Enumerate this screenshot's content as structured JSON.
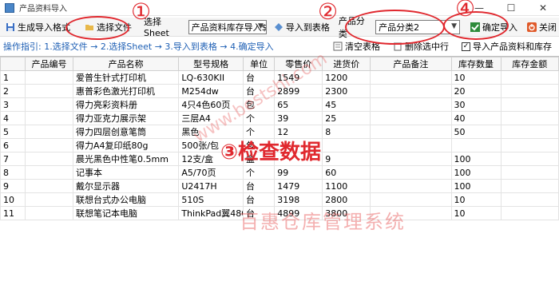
{
  "window": {
    "title": "产品资料导入",
    "minimize": "—",
    "maximize": "☐",
    "close": "✕"
  },
  "toolbar": {
    "gen_format": "生成导入格式",
    "select_file": "选择文件",
    "select_sheet_label": "选择Sheet",
    "sheet_value": "产品资料库存导入$",
    "import_table": "导入到表格",
    "category_label": "产品分类",
    "category_value": "产品分类2",
    "confirm_import": "确定导入",
    "close": "关闭"
  },
  "guide": {
    "text": "操作指引: 1.选择文件 → 2.选择Sheet → 3.导入到表格 → 4.确定导入",
    "clear_table": "清空表格",
    "delete_row": "删除选中行",
    "import_checkbox": "导入产品资料和库存",
    "import_checked": true
  },
  "table": {
    "headers": [
      "",
      "产品编号",
      "产品名称",
      "型号规格",
      "单位",
      "零售价",
      "进货价",
      "产品备注",
      "库存数量",
      "库存金额"
    ],
    "rows": [
      [
        "1",
        "",
        "爱普生针式打印机",
        "LQ-630KII",
        "台",
        "1549",
        "1200",
        "",
        "10",
        ""
      ],
      [
        "2",
        "",
        "惠普彩色激光打印机",
        "M254dw",
        "台",
        "2899",
        "2300",
        "",
        "20",
        ""
      ],
      [
        "3",
        "",
        "得力亮彩资料册",
        "4只4色60页",
        "包",
        "65",
        "45",
        "",
        "30",
        ""
      ],
      [
        "4",
        "",
        "得力亚克力展示架",
        "三层A4",
        "个",
        "39",
        "25",
        "",
        "40",
        ""
      ],
      [
        "5",
        "",
        "得力四层创意笔筒",
        "黑色",
        "个",
        "12",
        "8",
        "",
        "50",
        ""
      ],
      [
        "6",
        "",
        "得力A4复印纸80g",
        "500张/包",
        "包",
        "",
        "",
        "",
        "",
        ""
      ],
      [
        "7",
        "",
        "晨光黑色中性笔0.5mm",
        "12支/盒",
        "盒",
        "",
        "9",
        "",
        "100",
        ""
      ],
      [
        "8",
        "",
        "记事本",
        "A5/70页",
        "个",
        "99",
        "60",
        "",
        "100",
        ""
      ],
      [
        "9",
        "",
        "戴尔显示器",
        "U2417H",
        "台",
        "1479",
        "1100",
        "",
        "100",
        ""
      ],
      [
        "10",
        "",
        "联想台式办公电脑",
        "510S",
        "台",
        "3198",
        "2800",
        "",
        "10",
        ""
      ],
      [
        "11",
        "",
        "联想笔记本电脑",
        "ThinkPad翼480",
        "台",
        "4899",
        "3800",
        "",
        "10",
        ""
      ]
    ]
  },
  "annotations": {
    "n1": "①",
    "n2": "②",
    "n4": "④",
    "check": "③检查数据",
    "watermark": "百惠仓库管理系统",
    "url": "www.bestshi.com"
  }
}
